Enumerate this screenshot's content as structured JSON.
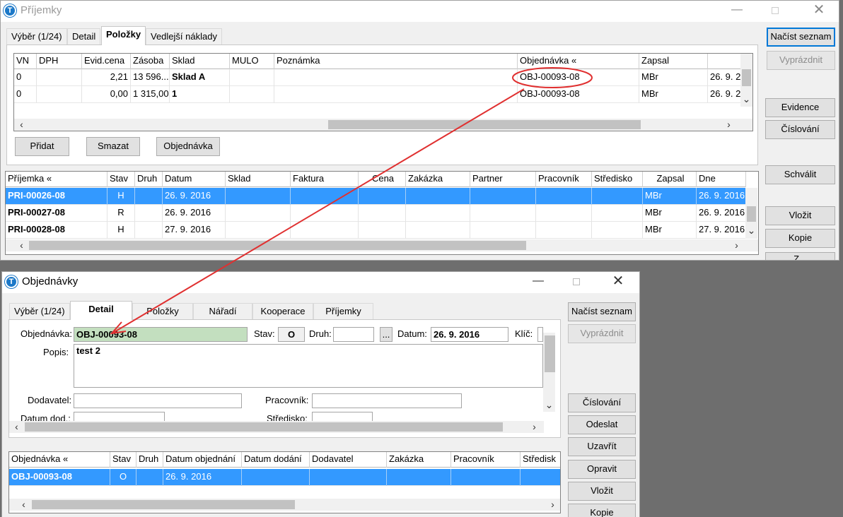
{
  "w1": {
    "title": "Příjemky",
    "tabs": [
      "Výběr (1/24)",
      "Detail",
      "Položky",
      "Vedlejší náklady"
    ],
    "items_headers": [
      "VN",
      "DPH",
      "Evid.cena",
      "Zásoba",
      "Sklad",
      "MULO",
      "Poznámka",
      "Objednávka «",
      "Zapsal",
      ""
    ],
    "items_rows": [
      [
        "0",
        "",
        "2,21",
        "13 596...",
        "Sklad A",
        "",
        "",
        "OBJ-00093-08",
        "MBr",
        "26. 9. 2"
      ],
      [
        "0",
        "",
        "0,00",
        "1 315,00",
        "1",
        "",
        "",
        "OBJ-00093-08",
        "MBr",
        "26. 9. 2"
      ]
    ],
    "buttons": {
      "add": "Přidat",
      "delete": "Smazat",
      "order": "Objednávka"
    },
    "list_headers": [
      "Příjemka «",
      "Stav",
      "Druh",
      "Datum",
      "Sklad",
      "Faktura",
      "Cena",
      "Zakázka",
      "Partner",
      "Pracovník",
      "Středisko",
      "Zapsal",
      "Dne"
    ],
    "list_rows": [
      [
        "PRI-00026-08",
        "H",
        "",
        "26. 9. 2016",
        "",
        "",
        "",
        "",
        "",
        "",
        "",
        "MBr",
        "26. 9. 2016"
      ],
      [
        "PRI-00027-08",
        "R",
        "",
        "26. 9. 2016",
        "",
        "",
        "",
        "",
        "",
        "",
        "",
        "MBr",
        "26. 9. 2016"
      ],
      [
        "PRI-00028-08",
        "H",
        "",
        "27. 9. 2016",
        "",
        "",
        "",
        "",
        "",
        "",
        "",
        "MBr",
        "27. 9. 2016"
      ]
    ],
    "side": {
      "load_list": "Načíst seznam",
      "clear": "Vyprázdnit",
      "evidence": "Evidence",
      "numbering": "Číslování",
      "approve": "Schválit",
      "insert": "Vložit",
      "copy": "Kopie",
      "partial": "Z..."
    }
  },
  "w2": {
    "title": "Objednávky",
    "tabs": [
      "Výběr (1/24)",
      "Detail",
      "Položky",
      "Nářadí",
      "Kooperace",
      "Příjemky"
    ],
    "form": {
      "order_label": "Objednávka:",
      "order_value": "OBJ-00093-08",
      "state_label": "Stav:",
      "state_value": "O",
      "kind_label": "Druh:",
      "kind_value": "",
      "lookup": "...",
      "date_label": "Datum:",
      "date_value": "26. 9. 2016",
      "key_label": "Klíč:",
      "desc_label": "Popis:",
      "desc_value": "test 2",
      "supplier_label": "Dodavatel:",
      "worker_label": "Pracovník:",
      "delivery_label": "Datum dod.:",
      "center_label": "Středisko:"
    },
    "list_headers": [
      "Objednávka «",
      "Stav",
      "Druh",
      "Datum objednání",
      "Datum dodání",
      "Dodavatel",
      "Zakázka",
      "Pracovník",
      "Středisk"
    ],
    "list_rows": [
      [
        "OBJ-00093-08",
        "O",
        "",
        "26. 9. 2016",
        "",
        "",
        "",
        "",
        ""
      ]
    ],
    "side": {
      "load_list": "Načíst seznam",
      "clear": "Vyprázdnit",
      "numbering": "Číslování",
      "send": "Odeslat",
      "close": "Uzavřít",
      "fix": "Opravit",
      "insert": "Vložit",
      "copy": "Kopie"
    }
  },
  "annotation_color": "#e03030",
  "icons": {
    "app": "T",
    "minimize": "minimize-icon",
    "maximize": "maximize-icon",
    "close": "close-icon"
  }
}
